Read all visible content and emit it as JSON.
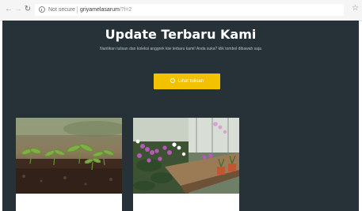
{
  "browser": {
    "security_label": "Not secure",
    "url_host": "griyamelasarum",
    "url_rest": "/?l=2",
    "icons": {
      "back": "arrow-left-icon",
      "forward": "arrow-right-icon",
      "reload": "reload-icon",
      "info": "info-icon",
      "bookmark": "star-icon"
    }
  },
  "hero": {
    "title": "Update Terbaru Kami",
    "subtitle": "Nantikan tulisan dan koleksi anggrek kiw terbaru kami! Anda suka? klik tombol dibawah saja",
    "button_label": "Lihat tulisan",
    "button_color": "#f2c200",
    "background_color": "#263238"
  },
  "cards": [
    {
      "image": "seedlings-in-soil-photo",
      "title": ""
    },
    {
      "image": "orchid-greenhouse-photo",
      "title": ""
    }
  ]
}
